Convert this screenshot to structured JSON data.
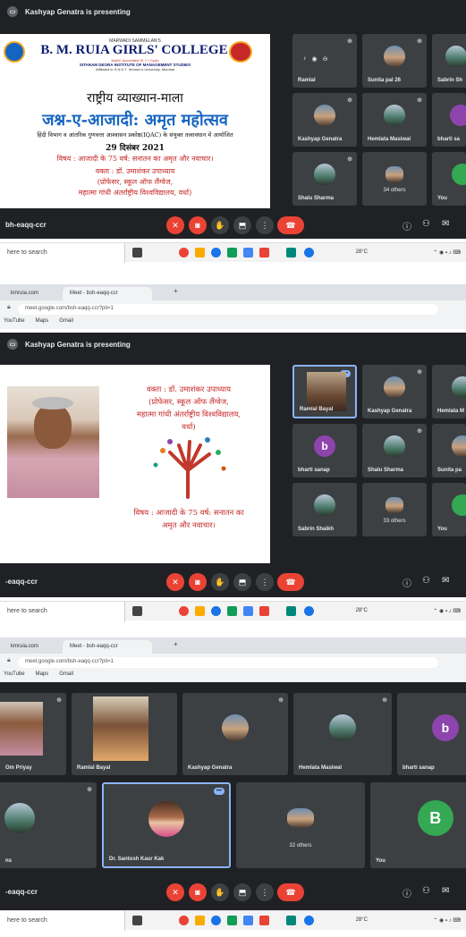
{
  "presenting_text": "Kashyap Genatra is presenting",
  "meeting_code": "-eaqq-ccr",
  "meeting_code_top": "bh-eaqq-ccr",
  "taskbar_search": "here to search",
  "weather": "28°C",
  "browser": {
    "tab1": "kmruia.com",
    "tab2": "Meet - bsh-eaqq-ccr",
    "new_tab": "+",
    "url": "meet.google.com/bsh-eaqq-ccr?pli=1",
    "bookmarks": [
      "YouTube",
      "Maps",
      "Gmail"
    ]
  },
  "slide1": {
    "org_top": "MARWADI SAMMELAN'S",
    "college": "B. M. RUIA GIRLS' COLLEGE",
    "naac": "NAAC Accredited 'B' ++ Cycle",
    "inst": "SITARAM DEORA INSTITUTE OF MANAGEMENT STUDIES",
    "affil": "Affiliated to S.N.D.T. Women's University, Mumbai",
    "series": "राष्ट्रीय व्याख्यान-माला",
    "festival": "जश्न-ए-आजादी: अमृत महोत्सव",
    "organisers": "हिंदी विभाग व आंतरिक गुणवत्ता आश्वासन प्रकोष्ठ(IQAC) के संयुक्त तत्वावधान में आयोजित",
    "date": "29 दिसंबर 2021",
    "topic": "विषय : आजादी के 75 वर्ष: सनातन का अमृत और नवाचार।",
    "speaker": "वक्ता : डॉ. उमाशंकर उपाध्याय",
    "speaker_pos": "(प्रोफेसर, स्कूल ऑफ लैंग्वेज,",
    "speaker_univ": "महात्मा गांधी अंतर्राष्ट्रीय विश्वविद्यालय, वर्धा)"
  },
  "slide2": {
    "speaker": "वक्ता : डॉ. उमाशंकर उपाध्याय",
    "speaker_pos": "(प्रोफेसर, स्कूल ऑफ लैंग्वेज,",
    "speaker_univ": "महात्मा गांधी अंतर्राष्ट्रीय विश्वविद्यालय,",
    "speaker_city": "वर्धा)",
    "topic_line1": "विषय : आजादी के 75 वर्ष: सनातन का",
    "topic_line2": "अमृत और नवाचार।"
  },
  "panel1_tiles": [
    "Ramlal",
    "Sunita pal 26",
    "Sabrin Sh",
    "Kashyap Genatra",
    "Hemlata Masiwal",
    "bharti sa",
    "Shalu Sharma",
    "34 others",
    "You"
  ],
  "panel2_tiles": [
    "Ramlal Bayal",
    "Kashyap Genatra",
    "Hemlata M",
    "bharti sanap",
    "Shalu Sharma",
    "Sunita pa",
    "Sabrin Shaikh",
    "33 others",
    "You"
  ],
  "panel3_tiles": [
    "Om Priyay",
    "Ramlal Bayal",
    "Kashyap Genatra",
    "Hemlata Masiwal",
    "bharti sanap",
    "ns",
    "Dr. Santosh Kaur Kak",
    "32 others",
    "You"
  ],
  "letters": {
    "b": "b",
    "B": "B"
  },
  "colors": {
    "meet_bg": "#202124",
    "tile_bg": "#3c4043",
    "red": "#ea4335",
    "blue": "#8ab4f8",
    "slide_title_blue": "#1a237e",
    "slide_red": "#c62828",
    "green_avatar": "#34a853",
    "purple_avatar": "#8e44ad"
  }
}
